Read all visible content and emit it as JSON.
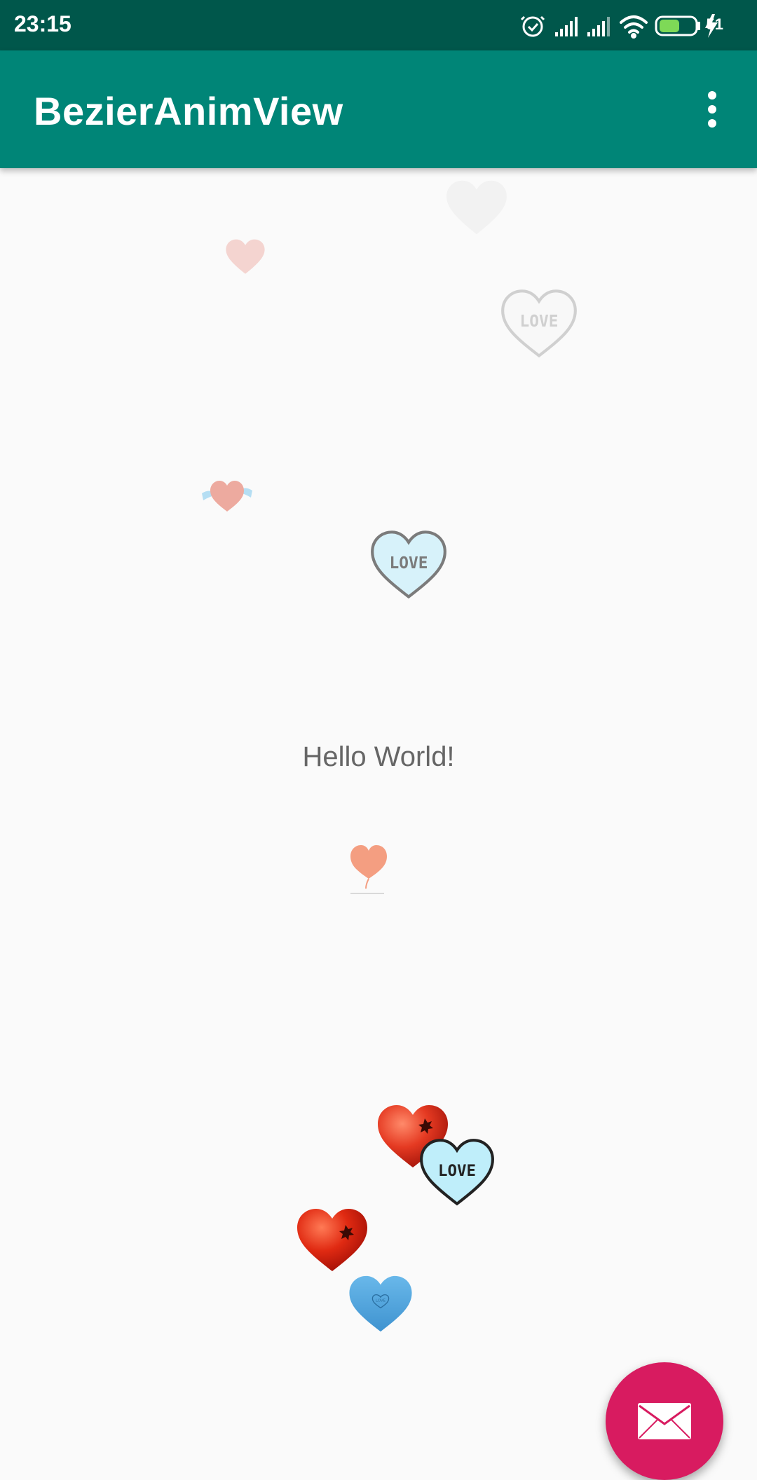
{
  "status_bar": {
    "time": "23:15",
    "battery": "51",
    "icons": [
      "alarm-icon",
      "signal-icon",
      "signal-icon",
      "wifi-icon",
      "battery-icon",
      "charging-icon"
    ]
  },
  "app_bar": {
    "title": "BezierAnimView",
    "menu_icon": "more-vert-icon"
  },
  "main": {
    "text": "Hello World!"
  },
  "hearts": {
    "love_label": "LOVE",
    "small_love_label": "LOVE"
  },
  "fab": {
    "icon": "email-icon"
  },
  "colors": {
    "status_bar": "#00574b",
    "primary": "#008577",
    "accent": "#d81b60",
    "background": "#fafafa"
  }
}
